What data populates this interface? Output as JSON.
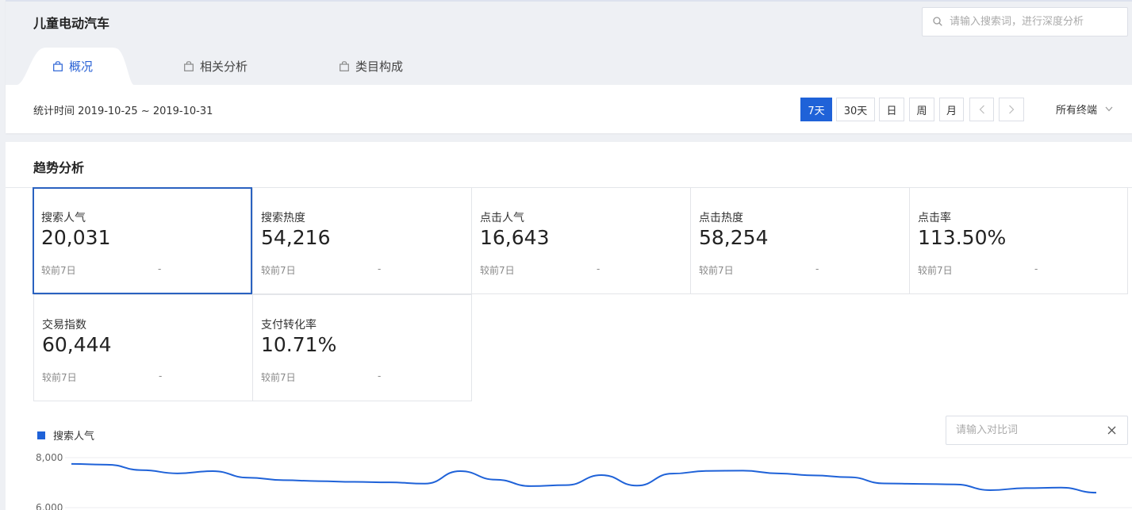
{
  "header": {
    "title": "儿童电动汽车",
    "search_placeholder": "请输入搜索词，进行深度分析",
    "search_icon": "search-icon"
  },
  "tabs": [
    {
      "label": "概况",
      "icon": "shopping-bag-icon",
      "active": true
    },
    {
      "label": "相关分析",
      "icon": "shopping-bag-icon",
      "active": false
    },
    {
      "label": "类目构成",
      "icon": "shopping-bag-icon",
      "active": false
    }
  ],
  "toolbar": {
    "stat_time": "统计时间 2019-10-25 ~ 2019-10-31",
    "ranges": [
      "7天",
      "30天",
      "日",
      "周",
      "月"
    ],
    "active_range": "7天",
    "terminal_label": "所有终端"
  },
  "trend": {
    "title": "趋势分析",
    "metrics": [
      {
        "label": "搜索人气",
        "value": "20,031",
        "compare_label": "较前7日",
        "compare_value": "-"
      },
      {
        "label": "搜索热度",
        "value": "54,216",
        "compare_label": "较前7日",
        "compare_value": "-"
      },
      {
        "label": "点击人气",
        "value": "16,643",
        "compare_label": "较前7日",
        "compare_value": "-"
      },
      {
        "label": "点击热度",
        "value": "58,254",
        "compare_label": "较前7日",
        "compare_value": "-"
      },
      {
        "label": "点击率",
        "value": "113.50%",
        "compare_label": "较前7日",
        "compare_value": "-"
      },
      {
        "label": "交易指数",
        "value": "60,444",
        "compare_label": "较前7日",
        "compare_value": "-"
      },
      {
        "label": "支付转化率",
        "value": "10.71%",
        "compare_label": "较前7日",
        "compare_value": "-"
      }
    ],
    "selected_metric": "搜索人气",
    "compare_placeholder": "请输入对比词"
  },
  "chart_data": {
    "type": "line",
    "series": [
      {
        "name": "搜索人气",
        "color": "#1f62d8",
        "values": [
          7750,
          7720,
          7500,
          7370,
          7460,
          7200,
          7100,
          7060,
          7030,
          7010,
          6960,
          7460,
          7120,
          6860,
          6900,
          7300,
          6880,
          7360,
          7470,
          7480,
          7370,
          7290,
          7220,
          6970,
          6950,
          6930,
          6700,
          6780,
          6800,
          6600
        ]
      }
    ],
    "yticks": [
      "8,000",
      "6,000"
    ],
    "ylim": [
      6000,
      8000
    ],
    "grid": true
  }
}
